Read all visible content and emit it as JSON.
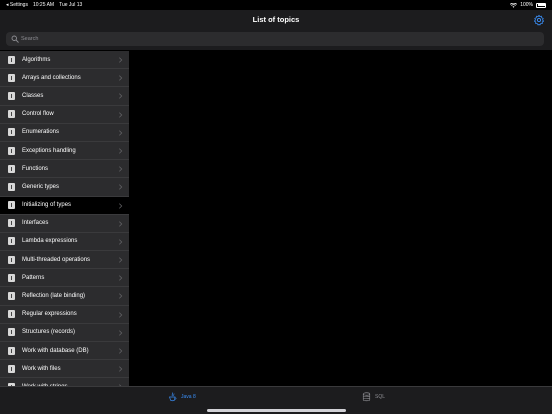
{
  "status_bar": {
    "back_app": "◂ Settings",
    "time": "10:25 AM",
    "date": "Tue Jul 13",
    "battery": "100%"
  },
  "nav": {
    "title": "List of topics"
  },
  "search": {
    "placeholder": "Search"
  },
  "topics": [
    {
      "label": "Algorithms"
    },
    {
      "label": "Arrays and collections"
    },
    {
      "label": "Classes"
    },
    {
      "label": "Control flow"
    },
    {
      "label": "Enumerations"
    },
    {
      "label": "Exceptions handling"
    },
    {
      "label": "Functions"
    },
    {
      "label": "Generic types"
    },
    {
      "label": "Initializing of types",
      "selected": true
    },
    {
      "label": "Interfaces"
    },
    {
      "label": "Lambda expressions"
    },
    {
      "label": "Multi-threaded operations"
    },
    {
      "label": "Patterns"
    },
    {
      "label": "Reflection (late binding)"
    },
    {
      "label": "Regular expressions"
    },
    {
      "label": "Structures (records)"
    },
    {
      "label": "Work with database (DB)"
    },
    {
      "label": "Work with files"
    },
    {
      "label": "Work with strings"
    }
  ],
  "tabs": [
    {
      "label": "Java 8",
      "icon": "java-icon",
      "selected": true
    },
    {
      "label": "SQL",
      "icon": "database-icon",
      "selected": false
    }
  ],
  "colors": {
    "accent": "#3a8ef6",
    "sidebar_bg": "#2c2c2e",
    "nav_bg": "#1c1c1e",
    "selected_bg": "#000000"
  }
}
